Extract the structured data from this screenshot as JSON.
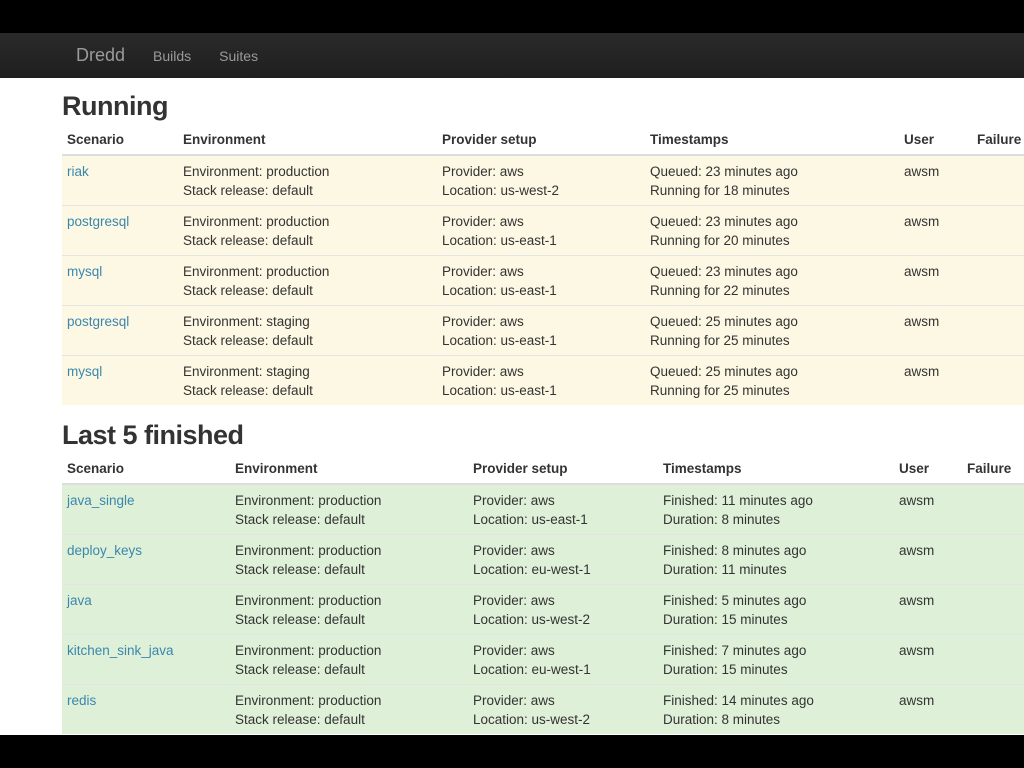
{
  "nav": {
    "brand": "Dredd",
    "links": [
      "Builds",
      "Suites"
    ]
  },
  "running": {
    "title": "Running",
    "headers": [
      "Scenario",
      "Environment",
      "Provider setup",
      "Timestamps",
      "User",
      "Failure"
    ],
    "rows": [
      {
        "scenario": "riak",
        "env1": "Environment: production",
        "env2": "Stack release: default",
        "prov1": "Provider: aws",
        "prov2": "Location: us-west-2",
        "ts1": "Queued: 23 minutes ago",
        "ts2": "Running for 18 minutes",
        "user": "awsm",
        "failure": ""
      },
      {
        "scenario": "postgresql",
        "env1": "Environment: production",
        "env2": "Stack release: default",
        "prov1": "Provider: aws",
        "prov2": "Location: us-east-1",
        "ts1": "Queued: 23 minutes ago",
        "ts2": "Running for 20 minutes",
        "user": "awsm",
        "failure": ""
      },
      {
        "scenario": "mysql",
        "env1": "Environment: production",
        "env2": "Stack release: default",
        "prov1": "Provider: aws",
        "prov2": "Location: us-east-1",
        "ts1": "Queued: 23 minutes ago",
        "ts2": "Running for 22 minutes",
        "user": "awsm",
        "failure": ""
      },
      {
        "scenario": "postgresql",
        "env1": "Environment: staging",
        "env2": "Stack release: default",
        "prov1": "Provider: aws",
        "prov2": "Location: us-east-1",
        "ts1": "Queued: 25 minutes ago",
        "ts2": "Running for 25 minutes",
        "user": "awsm",
        "failure": ""
      },
      {
        "scenario": "mysql",
        "env1": "Environment: staging",
        "env2": "Stack release: default",
        "prov1": "Provider: aws",
        "prov2": "Location: us-east-1",
        "ts1": "Queued: 25 minutes ago",
        "ts2": "Running for 25 minutes",
        "user": "awsm",
        "failure": ""
      }
    ]
  },
  "finished": {
    "title": "Last 5 finished",
    "headers": [
      "Scenario",
      "Environment",
      "Provider setup",
      "Timestamps",
      "User",
      "Failure"
    ],
    "rows": [
      {
        "scenario": "java_single",
        "env1": "Environment: production",
        "env2": "Stack release: default",
        "prov1": "Provider: aws",
        "prov2": "Location: us-east-1",
        "ts1": "Finished: 11 minutes ago",
        "ts2": "Duration: 8 minutes",
        "user": "awsm",
        "failure": ""
      },
      {
        "scenario": "deploy_keys",
        "env1": "Environment: production",
        "env2": "Stack release: default",
        "prov1": "Provider: aws",
        "prov2": "Location: eu-west-1",
        "ts1": "Finished: 8 minutes ago",
        "ts2": "Duration: 11 minutes",
        "user": "awsm",
        "failure": ""
      },
      {
        "scenario": "java",
        "env1": "Environment: production",
        "env2": "Stack release: default",
        "prov1": "Provider: aws",
        "prov2": "Location: us-west-2",
        "ts1": "Finished: 5 minutes ago",
        "ts2": "Duration: 15 minutes",
        "user": "awsm",
        "failure": ""
      },
      {
        "scenario": "kitchen_sink_java",
        "env1": "Environment: production",
        "env2": "Stack release: default",
        "prov1": "Provider: aws",
        "prov2": "Location: eu-west-1",
        "ts1": "Finished: 7 minutes ago",
        "ts2": "Duration: 15 minutes",
        "user": "awsm",
        "failure": ""
      },
      {
        "scenario": "redis",
        "env1": "Environment: production",
        "env2": "Stack release: default",
        "prov1": "Provider: aws",
        "prov2": "Location: us-west-2",
        "ts1": "Finished: 14 minutes ago",
        "ts2": "Duration: 8 minutes",
        "user": "awsm",
        "failure": ""
      }
    ]
  },
  "colors": {
    "running_row": "#fcf8e3",
    "finished_row": "#dff0d8",
    "link": "#3a87ad",
    "navbar": "#222222"
  }
}
